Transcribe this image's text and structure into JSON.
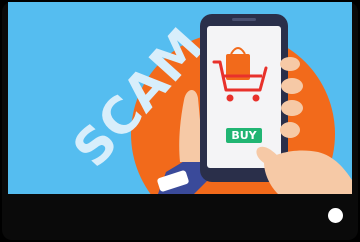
{
  "image": {
    "headline": "SCAM",
    "button_label": "BUY"
  },
  "colors": {
    "sky": "#55bdf0",
    "orange_circle": "#f26a1b",
    "phone_body": "#2a2f4a",
    "phone_screen": "#f4f4f6",
    "buy_button": "#21b573",
    "cart": "#e8312b",
    "skin": "#f6c9a6",
    "sleeve": "#3a4a9a"
  },
  "icons": {
    "cart": "shopping-cart-icon",
    "bag": "shopping-bag-icon"
  }
}
